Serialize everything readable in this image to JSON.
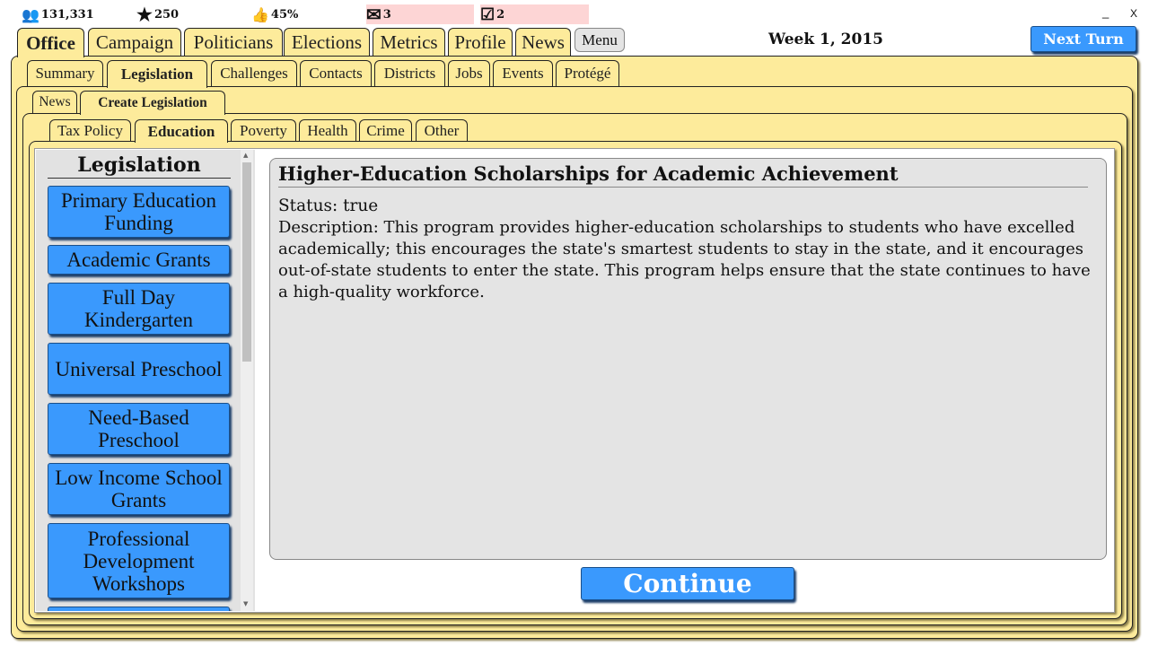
{
  "stats": {
    "followers": "131,331",
    "stars": "250",
    "approval": "45%",
    "messages": "3",
    "tasks": "2"
  },
  "window": {
    "minimize": "_",
    "close": "X"
  },
  "main_tabs": [
    "Office",
    "Campaign",
    "Politicians",
    "Elections",
    "Metrics",
    "Profile",
    "News"
  ],
  "menu_label": "Menu",
  "date": "Week 1, 2015",
  "next_turn": "Next Turn",
  "sub_tabs": [
    "Summary",
    "Legislation",
    "Challenges",
    "Contacts",
    "Districts",
    "Jobs",
    "Events",
    "Protégé"
  ],
  "leg_tabs": [
    "News",
    "Create Legislation"
  ],
  "cat_tabs": [
    "Tax Policy",
    "Education",
    "Poverty",
    "Health",
    "Crime",
    "Other"
  ],
  "list": {
    "title": "Legislation",
    "items": [
      "Primary Education Funding",
      "Academic Grants",
      "Full Day Kindergarten",
      "Universal Preschool",
      "Need-Based Preschool",
      "Low Income School Grants",
      "Professional Development Workshops"
    ]
  },
  "detail": {
    "title": "Higher-Education Scholarships for Academic Achievement",
    "status": "Status: true",
    "description": "Description: This program provides higher-education scholarships to students who have excelled academically; this encourages the state's smartest students to stay in the state, and it encourages out-of-state students to enter the state. This program helps ensure that the state continues to have a high-quality workforce."
  },
  "continue": "Continue",
  "colors": {
    "panel": "#fdeb9b",
    "button": "#3a99fd",
    "alert": "#fdd5d5"
  }
}
